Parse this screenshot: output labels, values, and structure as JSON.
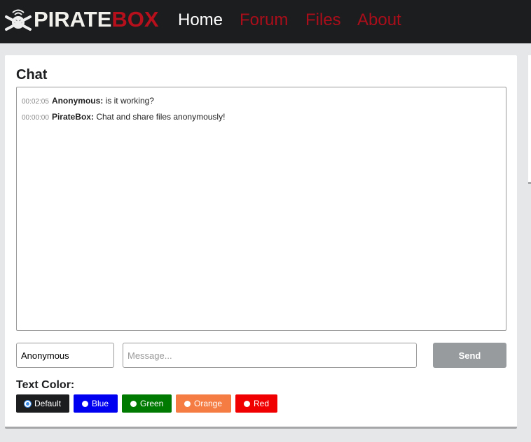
{
  "nav": {
    "logo_main": "PIRATE",
    "logo_accent": "BOX",
    "items": [
      "Home",
      "Forum",
      "Files",
      "About"
    ]
  },
  "chat": {
    "title": "Chat",
    "messages": [
      {
        "time": "00:02:05",
        "user": "Anonymous:",
        "text": "is it working?"
      },
      {
        "time": "00:00:00",
        "user": "PirateBox:",
        "text": "Chat and share files anonymously!"
      }
    ],
    "name_value": "Anonymous",
    "message_placeholder": "Message...",
    "send_label": "Send",
    "text_color_label": "Text Color:",
    "colors": [
      {
        "label": "Default",
        "color": "#1c1d1f",
        "selected": true
      },
      {
        "label": "Blue",
        "color": "#0000f0"
      },
      {
        "label": "Green",
        "color": "#007a00"
      },
      {
        "label": "Orange",
        "color": "#f57c42"
      },
      {
        "label": "Red",
        "color": "#f00000"
      }
    ]
  }
}
